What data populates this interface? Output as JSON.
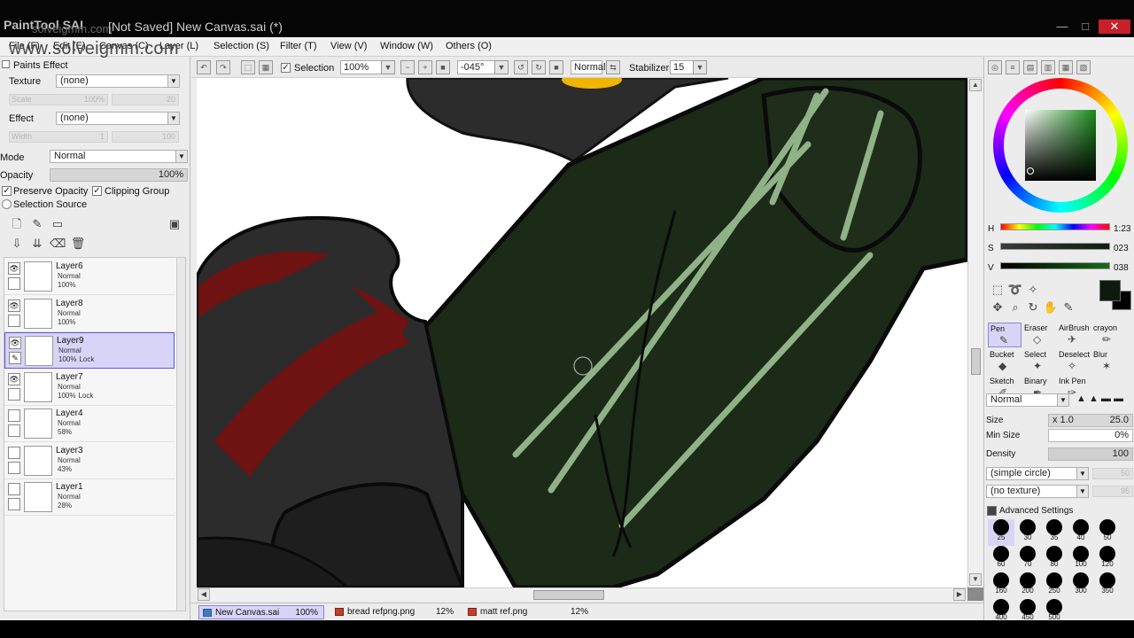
{
  "window": {
    "app_name": "PaintTool SAI",
    "title": "[Not Saved] New Canvas.sai (*)",
    "overlay_text": "solveigmm.com",
    "watermark": "www.solveigmm.com",
    "minimize": "—",
    "maximize": "□",
    "close": "✕"
  },
  "menu": {
    "items": [
      "File (F)",
      "Edit (E)",
      "Canvas (C)",
      "Layer (L)",
      "Selection (S)",
      "Filter (T)",
      "View (V)",
      "Window (W)",
      "Others (O)"
    ]
  },
  "left_panel": {
    "header": "Paints Effect",
    "texture_label": "Texture",
    "texture_value": "(none)",
    "scale_label": "Scale",
    "scale_value": "100%",
    "scale_right": "20",
    "effect_label": "Effect",
    "effect_value": "(none)",
    "width_label": "Width",
    "width_value": "1",
    "width_right": "100",
    "mode_label": "Mode",
    "mode_value": "Normal",
    "opacity_label": "Opacity",
    "opacity_value": "100%",
    "preserve_opacity": "Preserve Opacity",
    "clipping_group": "Clipping Group",
    "selection_source": "Selection Source"
  },
  "layers": [
    {
      "name": "Layer6",
      "mode": "Normal",
      "opacity": "100%",
      "lock": "",
      "visible": true,
      "selected": false
    },
    {
      "name": "Layer8",
      "mode": "Normal",
      "opacity": "100%",
      "lock": "",
      "visible": true,
      "selected": false
    },
    {
      "name": "Layer9",
      "mode": "Normal",
      "opacity": "100%",
      "lock": "Lock",
      "visible": true,
      "selected": true
    },
    {
      "name": "Layer7",
      "mode": "Normal",
      "opacity": "100%",
      "lock": "Lock",
      "visible": true,
      "selected": false
    },
    {
      "name": "Layer4",
      "mode": "Normal",
      "opacity": "58%",
      "lock": "",
      "visible": false,
      "selected": false
    },
    {
      "name": "Layer3",
      "mode": "Normal",
      "opacity": "43%",
      "lock": "",
      "visible": false,
      "selected": false
    },
    {
      "name": "Layer1",
      "mode": "Normal",
      "opacity": "28%",
      "lock": "",
      "visible": false,
      "selected": false
    }
  ],
  "toolbar": {
    "selection_label": "Selection",
    "zoom": "100%",
    "rotation": "-045°",
    "blend_mode": "Normal",
    "stabilizer_label": "Stabilizer",
    "stabilizer_value": "15"
  },
  "tabs": [
    {
      "name": "New Canvas.sai",
      "zoom": "100%",
      "active": true
    },
    {
      "name": "bread refpng.png",
      "zoom": "12%",
      "active": false
    },
    {
      "name": "matt ref.png",
      "zoom": "12%",
      "active": false
    }
  ],
  "right_panel": {
    "h_label": "H",
    "h_value": "1:23",
    "s_label": "S",
    "s_value": "023",
    "v_label": "V",
    "v_value": "038",
    "primary_color": "#0f1a0e",
    "tools": [
      {
        "name": "Pen",
        "glyph": "✎",
        "active": true
      },
      {
        "name": "Eraser",
        "glyph": "◇",
        "active": false
      },
      {
        "name": "AirBrush",
        "glyph": "✈",
        "active": false
      },
      {
        "name": "crayon",
        "glyph": "✏",
        "active": false
      },
      {
        "name": "Bucket",
        "glyph": "◆",
        "active": false
      },
      {
        "name": "Select",
        "glyph": "✦",
        "active": false
      },
      {
        "name": "Deselect",
        "glyph": "✧",
        "active": false
      },
      {
        "name": "Blur",
        "glyph": "✶",
        "active": false
      },
      {
        "name": "Sketch",
        "glyph": "✐",
        "active": false
      },
      {
        "name": "Binary",
        "glyph": "✒",
        "active": false
      },
      {
        "name": "Ink Pen",
        "glyph": "✑",
        "active": false
      }
    ],
    "brush_mode": "Normal",
    "size_label": "Size",
    "size_mult": "x 1.0",
    "size_value": "25.0",
    "min_size_label": "Min Size",
    "min_size_value": "0%",
    "density_label": "Density",
    "density_value": "100",
    "shape": "(simple circle)",
    "shape_right": "50",
    "texture": "(no texture)",
    "texture_right": "95",
    "advanced": "Advanced Settings",
    "brush_sizes": [
      "25",
      "30",
      "35",
      "40",
      "50",
      "60",
      "70",
      "80",
      "100",
      "120",
      "160",
      "200",
      "250",
      "300",
      "350",
      "400",
      "450",
      "500"
    ]
  },
  "colors": {
    "canvas_green": "#1c2a18",
    "stripe_green": "#8fb287",
    "dark_gray": "#2c2c2c",
    "red": "#6e1212",
    "selection_accent": "#5a55e0"
  }
}
